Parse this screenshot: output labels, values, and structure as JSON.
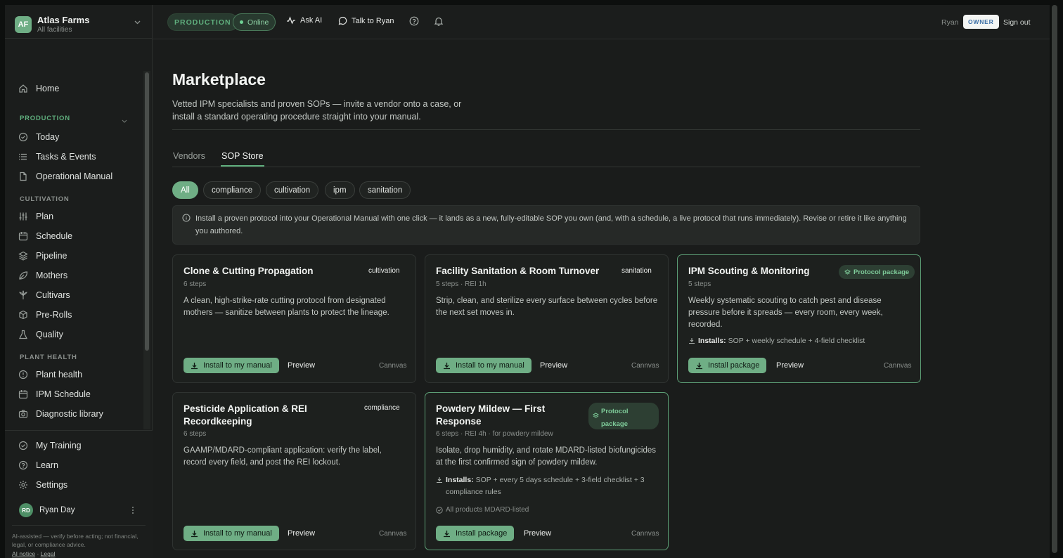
{
  "org": {
    "initials": "AF",
    "name": "Atlas Farms",
    "sub": "All facilities"
  },
  "nav": {
    "home": "Home",
    "production_section": "PRODUCTION",
    "today": "Today",
    "tasks": "Tasks & Events",
    "manual": "Operational Manual",
    "cultivation_section": "CULTIVATION",
    "plan": "Plan",
    "schedule": "Schedule",
    "pipeline": "Pipeline",
    "mothers": "Mothers",
    "cultivars": "Cultivars",
    "prerolls": "Pre-Rolls",
    "quality": "Quality",
    "plant_health_section": "PLANT HEALTH",
    "plant_health": "Plant health",
    "ipm_schedule": "IPM Schedule",
    "diagnostic": "Diagnostic library"
  },
  "bottom_nav": {
    "training": "My Training",
    "learn": "Learn",
    "settings": "Settings"
  },
  "user": {
    "initials": "RD",
    "name": "Ryan Day"
  },
  "disclaimer": {
    "text": "AI-assisted — verify before acting; not financial, legal, or compliance advice.",
    "ai_notice": "AI notice",
    "sep": "·",
    "legal": "Legal"
  },
  "topbar": {
    "env": "PRODUCTION",
    "status": "Online",
    "ask_ai": "Ask AI",
    "talk": "Talk to Ryan",
    "user": "Ryan",
    "role": "OWNER",
    "signout": "Sign out"
  },
  "page": {
    "title": "Marketplace",
    "description": "Vetted IPM specialists and proven SOPs — invite a vendor onto a case, or install a standard operating procedure straight into your manual.",
    "tabs": [
      "Vendors",
      "SOP Store"
    ],
    "filters": [
      "All",
      "compliance",
      "cultivation",
      "ipm",
      "sanitation"
    ],
    "info": "Install a proven protocol into your Operational Manual with one click — it lands as a new, fully-editable SOP you own (and, with a schedule, a live protocol that runs immediately). Revise or retire it like anything you authored."
  },
  "cards": [
    {
      "title": "Clone & Cutting Propagation",
      "tag": "cultivation",
      "meta": "6 steps",
      "desc": "A clean, high-strike-rate cutting protocol from designated mothers — sanitize between plants to protect the lineage.",
      "button": "Install to my manual",
      "preview": "Preview",
      "canvas": "Cannvas"
    },
    {
      "title": "Facility Sanitation & Room Turnover",
      "tag": "sanitation",
      "meta": "5 steps · REI 1h",
      "desc": "Strip, clean, and sterilize every surface between cycles before the next set moves in.",
      "button": "Install to my manual",
      "preview": "Preview",
      "canvas": "Cannvas"
    },
    {
      "title": "IPM Scouting & Monitoring",
      "badge": "Protocol package",
      "meta": "5 steps",
      "desc": "Weekly systematic scouting to catch pest and disease pressure before it spreads — every room, every week, recorded.",
      "installs_label": "Installs:",
      "installs": "SOP + weekly schedule + 4-field checklist",
      "button": "Install package",
      "preview": "Preview",
      "canvas": "Cannvas"
    },
    {
      "title": "Pesticide Application & REI Recordkeeping",
      "tag": "compliance",
      "meta": "6 steps",
      "desc": "GAAMP/MDARD-compliant application: verify the label, record every field, and post the REI lockout.",
      "button": "Install to my manual",
      "preview": "Preview",
      "canvas": "Cannvas"
    },
    {
      "title": "Powdery Mildew — First Response",
      "badge": "Protocol package",
      "meta": "6 steps · REI 4h · for powdery mildew",
      "desc": "Isolate, drop humidity, and rotate MDARD-listed biofungicides at the first confirmed sign of powdery mildew.",
      "installs_label": "Installs:",
      "installs": "SOP + every 5 days schedule + 3-field checklist + 3 compliance rules",
      "note": "All products MDARD-listed",
      "button": "Install package",
      "preview": "Preview",
      "canvas": "Cannvas"
    }
  ]
}
